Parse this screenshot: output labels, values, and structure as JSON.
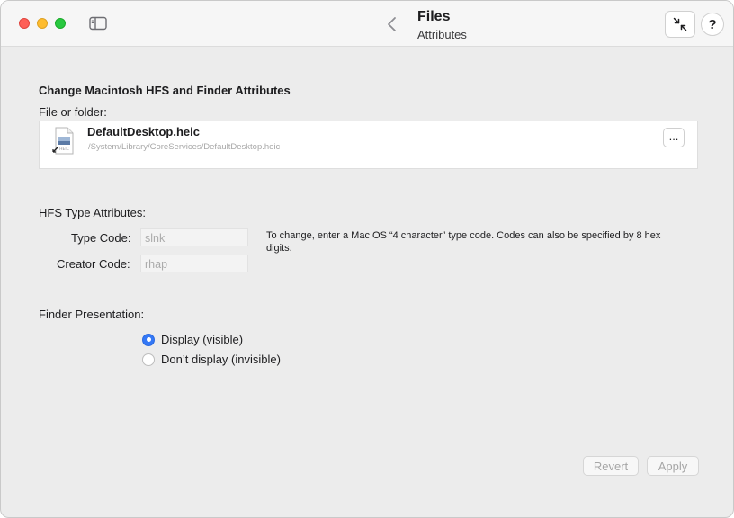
{
  "window": {
    "title": "Files",
    "subtitle": "Attributes",
    "help_label": "?"
  },
  "main": {
    "section_title": "Change Macintosh HFS and Finder Attributes",
    "file_label": "File or folder:",
    "file": {
      "name": "DefaultDesktop.heic",
      "path": "/System/Library/CoreServices/DefaultDesktop.heic",
      "icon_text": "HEIC",
      "more_label": "..."
    },
    "hfs": {
      "heading": "HFS Type Attributes:",
      "type_label": "Type Code:",
      "type_placeholder": "slnk",
      "creator_label": "Creator Code:",
      "creator_placeholder": "rhap",
      "hint": "To change, enter a Mac OS “4 character” type code. Codes can also be specified by 8 hex digits."
    },
    "finder": {
      "heading": "Finder Presentation:",
      "options": [
        {
          "label": "Display (visible)",
          "selected": true
        },
        {
          "label": "Don’t display (invisible)",
          "selected": false
        }
      ]
    },
    "buttons": {
      "revert": "Revert",
      "apply": "Apply"
    }
  },
  "colors": {
    "accent": "#3478f6",
    "close": "#fe5f57",
    "minimize": "#febc2e",
    "maximize": "#28c840"
  },
  "icons": [
    "sidebar-toggle-icon",
    "chevron-left-icon",
    "collapse-arrows-icon",
    "heic-file-icon"
  ]
}
